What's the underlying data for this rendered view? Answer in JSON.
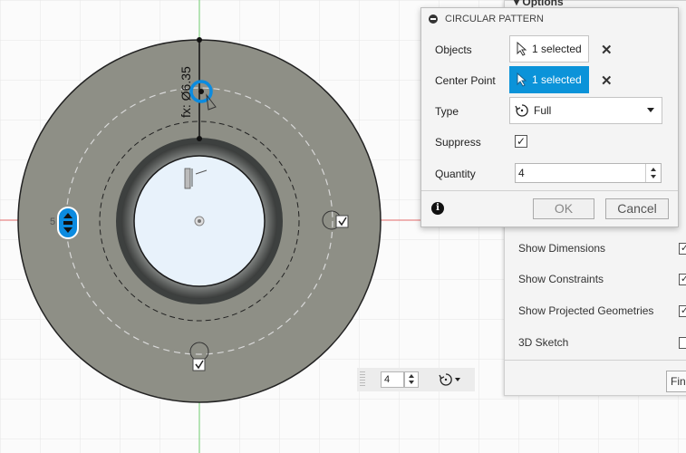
{
  "palette": {
    "header": "▾ Options",
    "rows": [
      {
        "label": "Show Dimensions",
        "checked": true
      },
      {
        "label": "Show Constraints",
        "checked": true
      },
      {
        "label": "Show Projected Geometries",
        "checked": true
      },
      {
        "label": "3D Sketch",
        "checked": false
      }
    ],
    "finish_label": "Fin"
  },
  "dialog": {
    "title": "CIRCULAR PATTERN",
    "objects_label": "Objects",
    "objects_value": "1 selected",
    "center_label": "Center Point",
    "center_value": "1 selected",
    "type_label": "Type",
    "type_value": "Full",
    "suppress_label": "Suppress",
    "suppress_checked": true,
    "quantity_label": "Quantity",
    "quantity_value": "4",
    "ok_label": "OK",
    "cancel_label": "Cancel"
  },
  "canvas": {
    "dimension_text": "fx: Ø6.35",
    "floating_quantity": "4",
    "colors": {
      "part_fill": "#8e8f86",
      "inner_ring": "#4a4c4b",
      "hole_fill": "#e8f2fb",
      "selection_blue": "#0b8be0",
      "axis_red": "#e26a6a",
      "axis_green": "#6fce6f",
      "grid": "#e6e6e6"
    }
  }
}
